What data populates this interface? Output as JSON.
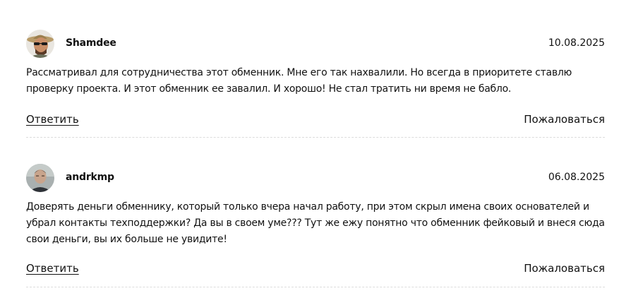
{
  "comments": [
    {
      "author": "Shamdee",
      "avatar_icon": "avatar-man-with-hat-and-sunglasses",
      "date": "10.08.2025",
      "text": "Рассматривал для сотрудничества этот обменник. Мне его так нахвалили. Но всегда в приоритете ставлю проверку проекта. И этот обменник ее завалил. И хорошо! Не стал тратить ни время не бабло.",
      "reply_label": "Ответить",
      "report_label": "Пожаловаться"
    },
    {
      "author": "andrkmp",
      "avatar_icon": "avatar-man-photo",
      "date": "06.08.2025",
      "text": "Доверять деньги обменнику, который только вчера начал работу, при этом скрыл имена своих основателей и убрал контакты техподдержки? Да вы в своем уме??? Тут же ежу понятно что обменник фейковый и внеся сюда свои деньги, вы их больше не увидите!",
      "reply_label": "Ответить",
      "report_label": "Пожаловаться"
    }
  ]
}
